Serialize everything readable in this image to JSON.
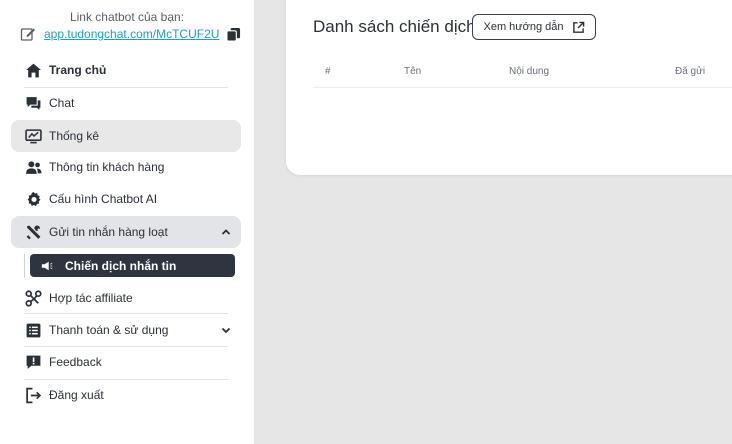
{
  "sidebar": {
    "link_caption": "Link chatbot của bạn:",
    "link_url": "app.tudongchat.com/McTCUF2U",
    "items": [
      {
        "label": "Trang chủ"
      },
      {
        "label": "Chat"
      },
      {
        "label": "Thống kê"
      },
      {
        "label": "Thông tin khách hàng"
      },
      {
        "label": "Cấu hình Chatbot AI"
      },
      {
        "label": "Gửi tin nhắn hàng loạt"
      },
      {
        "label": "Hợp tác affiliate"
      },
      {
        "label": "Thanh toán & sử dụng"
      },
      {
        "label": "Feedback"
      },
      {
        "label": "Đăng xuất"
      }
    ],
    "submenu": {
      "label": "Chiến dịch nhắn tin"
    }
  },
  "main": {
    "title": "Danh sách chiến dịch",
    "guide_button": "Xem hướng dẫn",
    "columns": [
      "#",
      "Tên",
      "Nội dung",
      "Đã gửi"
    ]
  },
  "colors": {
    "link": "#1da1c7",
    "active_submenu_bg": "#2e3440",
    "background": "#e6e6e6"
  }
}
